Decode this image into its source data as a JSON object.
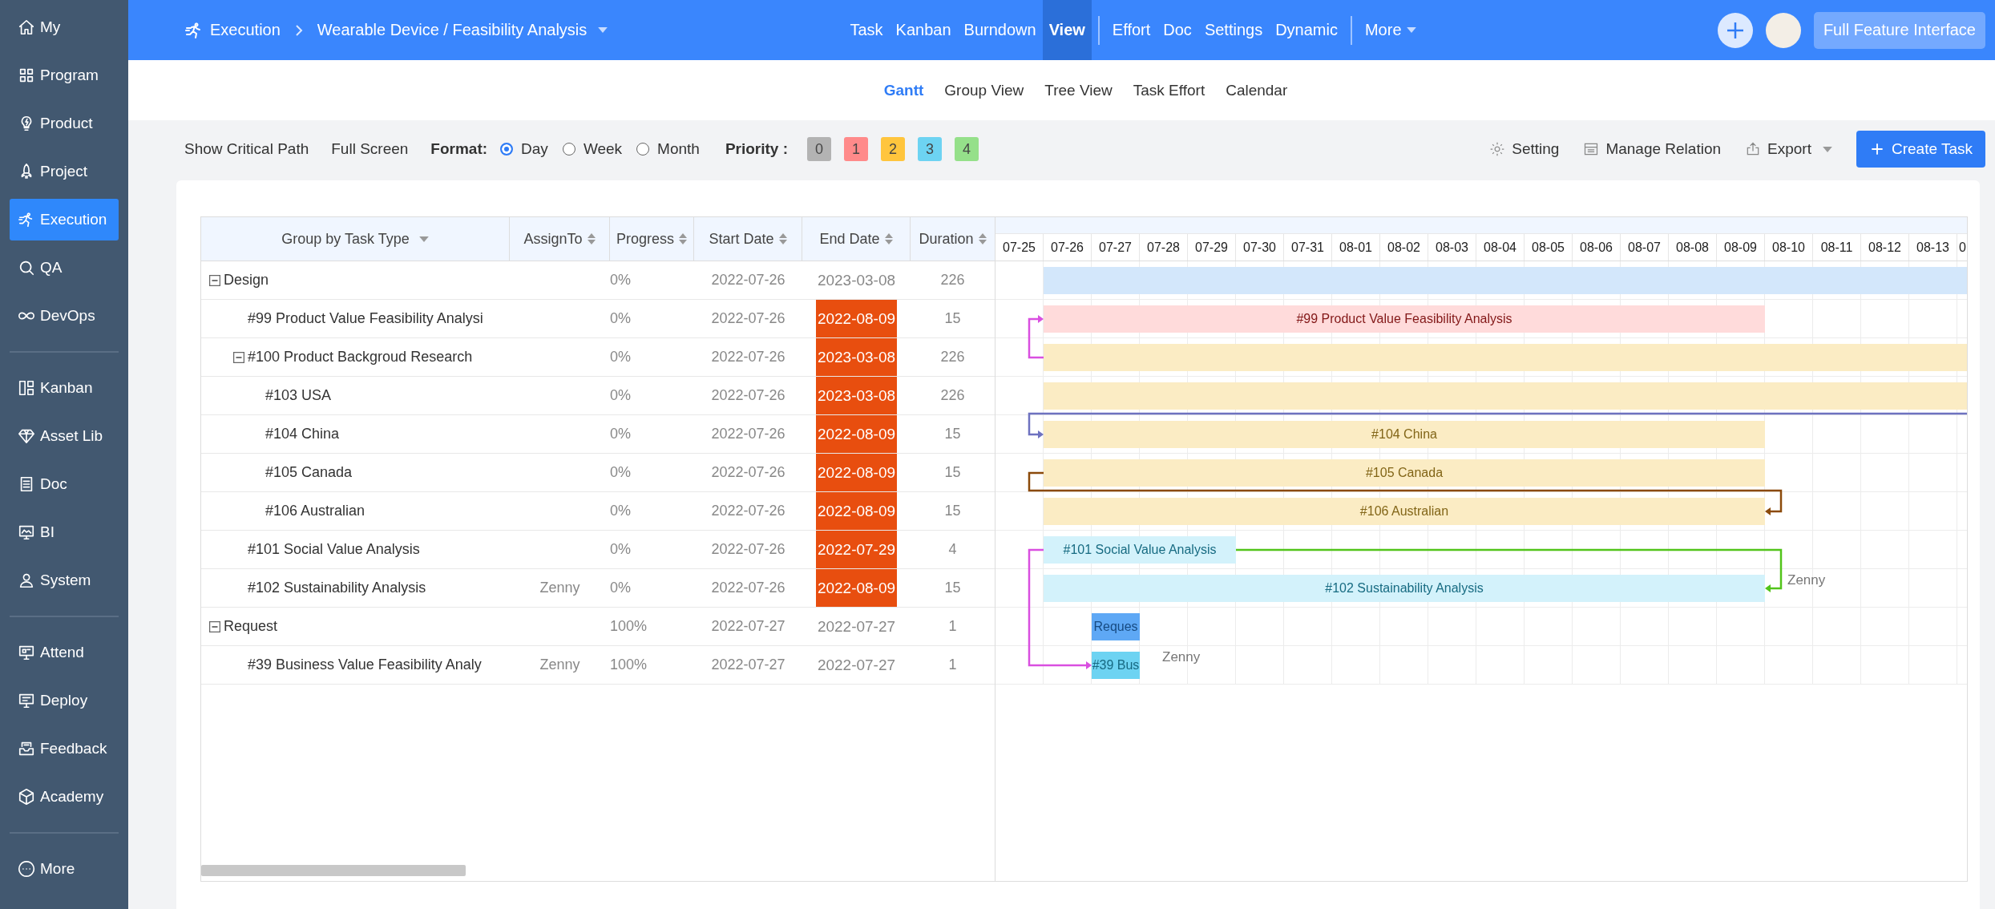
{
  "sidebar": {
    "groups": [
      {
        "items": [
          {
            "label": "My",
            "selected": false
          },
          {
            "label": "Program",
            "selected": false
          },
          {
            "label": "Product",
            "selected": false
          },
          {
            "label": "Project",
            "selected": false
          },
          {
            "label": "Execution",
            "selected": true
          },
          {
            "label": "QA",
            "selected": false
          },
          {
            "label": "DevOps",
            "selected": false
          }
        ]
      },
      {
        "items": [
          {
            "label": "Kanban",
            "selected": false
          },
          {
            "label": "Asset Lib",
            "selected": false
          },
          {
            "label": "Doc",
            "selected": false
          },
          {
            "label": "BI",
            "selected": false
          },
          {
            "label": "System",
            "selected": false
          }
        ]
      },
      {
        "items": [
          {
            "label": "Attend",
            "selected": false
          },
          {
            "label": "Deploy",
            "selected": false
          },
          {
            "label": "Feedback",
            "selected": false
          },
          {
            "label": "Academy",
            "selected": false
          }
        ]
      },
      {
        "items": [
          {
            "label": "More",
            "selected": false
          }
        ]
      }
    ]
  },
  "topbar": {
    "breadcrumb": {
      "section": "Execution",
      "path": "Wearable Device / Feasibility Analysis"
    },
    "nav_groups": [
      {
        "items": [
          {
            "label": "Task",
            "selected": false
          },
          {
            "label": "Kanban",
            "selected": false
          },
          {
            "label": "Burndown",
            "selected": false
          },
          {
            "label": "View",
            "selected": true
          }
        ]
      },
      {
        "items": [
          {
            "label": "Effort",
            "selected": false
          },
          {
            "label": "Doc",
            "selected": false
          },
          {
            "label": "Settings",
            "selected": false
          },
          {
            "label": "Dynamic",
            "selected": false
          }
        ]
      }
    ],
    "more": "More",
    "full_feature_button": "Full Feature Interface"
  },
  "subnav": [
    {
      "label": "Gantt",
      "selected": true
    },
    {
      "label": "Group View",
      "selected": false
    },
    {
      "label": "Tree View",
      "selected": false
    },
    {
      "label": "Task Effort",
      "selected": false
    },
    {
      "label": "Calendar",
      "selected": false
    }
  ],
  "toolbar": {
    "links": [
      "Show Critical Path",
      "Full Screen"
    ],
    "format": {
      "label": "Format:",
      "options": [
        {
          "label": "Day",
          "selected": true
        },
        {
          "label": "Week",
          "selected": false
        },
        {
          "label": "Month",
          "selected": false
        }
      ]
    },
    "priority": {
      "label": "Priority :",
      "levels": [
        {
          "label": "0",
          "color": "#b3b3b3"
        },
        {
          "label": "1",
          "color": "#ff8a8a"
        },
        {
          "label": "2",
          "color": "#ffc53d"
        },
        {
          "label": "3",
          "color": "#6dd3f2"
        },
        {
          "label": "4",
          "color": "#95e08a"
        }
      ]
    },
    "actions": [
      {
        "label": "Setting",
        "kind": "gear"
      },
      {
        "label": "Manage Relation",
        "kind": "list"
      },
      {
        "label": "Export",
        "kind": "export"
      }
    ],
    "create_button": "Create Task"
  },
  "table": {
    "columns": [
      {
        "label": "Group by Task Type",
        "kind": "dropdown"
      },
      {
        "label": "AssignTo",
        "kind": "sort"
      },
      {
        "label": "Progress",
        "kind": "sort"
      },
      {
        "label": "Start Date",
        "kind": "sort"
      },
      {
        "label": "End Date",
        "kind": "sort"
      },
      {
        "label": "Duration",
        "kind": "sort"
      }
    ],
    "rows": [
      {
        "title": "Design",
        "expanded": true,
        "progress": "0%",
        "start_date": "2022-07-26",
        "end_date": "2023-03-08",
        "overdue": false,
        "duration": "226",
        "bar": {
          "color": "#d3e7fb"
        },
        "children": [
          {
            "title": "#99 Product Value Feasibility Analysi",
            "progress": "0%",
            "start_date": "2022-07-26",
            "end_date": "2022-08-09",
            "overdue": true,
            "duration": "15",
            "bar": {
              "color": "#ffdbdb",
              "label": "#99 Product Value Feasibility Analysis"
            }
          },
          {
            "title": "#100 Product Backgroud Research",
            "expanded": true,
            "progress": "0%",
            "start_date": "2022-07-26",
            "end_date": "2023-03-08",
            "overdue": true,
            "duration": "226",
            "bar": {
              "color": "#fbecc4"
            },
            "children": [
              {
                "title": "#103 USA",
                "progress": "0%",
                "start_date": "2022-07-26",
                "end_date": "2023-03-08",
                "overdue": true,
                "duration": "226",
                "bar": {
                  "color": "#fbecc4"
                }
              },
              {
                "title": "#104 China",
                "progress": "0%",
                "start_date": "2022-07-26",
                "end_date": "2022-08-09",
                "overdue": true,
                "duration": "15",
                "bar": {
                  "color": "#fbecc4",
                  "label": "#104 China"
                }
              },
              {
                "title": "#105 Canada",
                "progress": "0%",
                "start_date": "2022-07-26",
                "end_date": "2022-08-09",
                "overdue": true,
                "duration": "15",
                "bar": {
                  "color": "#fbecc4",
                  "label": "#105 Canada"
                }
              },
              {
                "title": "#106 Australian",
                "progress": "0%",
                "start_date": "2022-07-26",
                "end_date": "2022-08-09",
                "overdue": true,
                "duration": "15",
                "bar": {
                  "color": "#fbecc4",
                  "label": "#106 Australian"
                }
              }
            ]
          },
          {
            "title": "#101 Social Value Analysis",
            "progress": "0%",
            "start_date": "2022-07-26",
            "end_date": "2022-07-29",
            "overdue": true,
            "duration": "4",
            "bar": {
              "color": "#d3f2fb",
              "label": "#101 Social Value Analysis"
            }
          },
          {
            "title": "#102 Sustainability Analysis",
            "assign_to": "Zenny",
            "progress": "0%",
            "start_date": "2022-07-26",
            "end_date": "2022-08-09",
            "overdue": true,
            "duration": "15",
            "bar": {
              "color": "#d3f2fb",
              "label": "#102 Sustainability Analysis",
              "assignee": "Zenny"
            }
          }
        ]
      },
      {
        "title": "Request",
        "expanded": true,
        "progress": "100%",
        "start_date": "2022-07-27",
        "end_date": "2022-07-27",
        "overdue": false,
        "duration": "1",
        "bar": {
          "color": "#5ea8f5",
          "label": "Reques"
        },
        "children": [
          {
            "title": "#39 Business Value Feasibility Analy",
            "assign_to": "Zenny",
            "progress": "100%",
            "start_date": "2022-07-27",
            "end_date": "2022-07-27",
            "overdue": false,
            "duration": "1",
            "bar": {
              "color": "#6dd3f2",
              "label": "#39 Bus",
              "assignee": "Zenny"
            }
          }
        ]
      }
    ]
  },
  "gantt": {
    "days": [
      "07-25",
      "07-26",
      "07-27",
      "07-28",
      "07-29",
      "07-30",
      "07-31",
      "08-01",
      "08-02",
      "08-03",
      "08-04",
      "08-05",
      "08-06",
      "08-07",
      "08-08",
      "08-09",
      "08-10",
      "08-11",
      "08-12",
      "08-13",
      "0"
    ]
  }
}
